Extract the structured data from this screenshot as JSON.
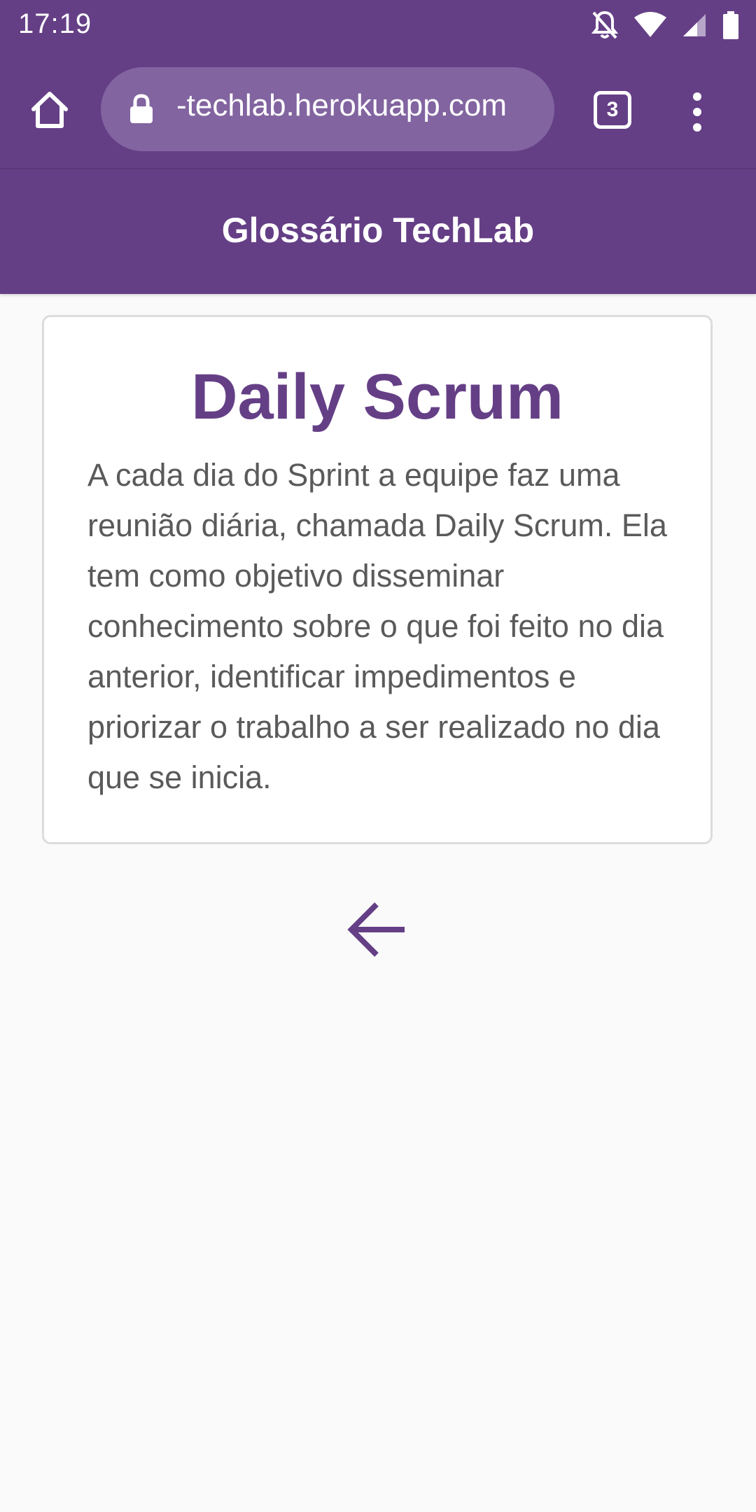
{
  "status_bar": {
    "time": "17:19",
    "icons": [
      "notifications-off-icon",
      "wifi-icon",
      "cell-signal-icon",
      "battery-icon"
    ]
  },
  "browser": {
    "url": "-techlab.herokuapp.com",
    "tab_count": "3",
    "icons": [
      "home-icon",
      "lock-icon",
      "tabs-icon",
      "more-vert-icon"
    ]
  },
  "header": {
    "title": "Glossário TechLab"
  },
  "term": {
    "title": "Daily Scrum",
    "description": "A cada dia do Sprint a equipe faz uma reunião diária, chamada Daily Scrum. Ela tem como objetivo disseminar conhecimento sobre o que foi feito no dia anterior, identificar impedimentos e priorizar o trabalho a ser realizado no dia que se inicia."
  },
  "navigation": {
    "back_icon": "arrow-back-icon"
  },
  "colors": {
    "primary": "#653f86",
    "url_pill": "#8264a0",
    "background": "#fafafa",
    "card_border": "#dcdcdc",
    "body_text": "#5a5a5a"
  }
}
